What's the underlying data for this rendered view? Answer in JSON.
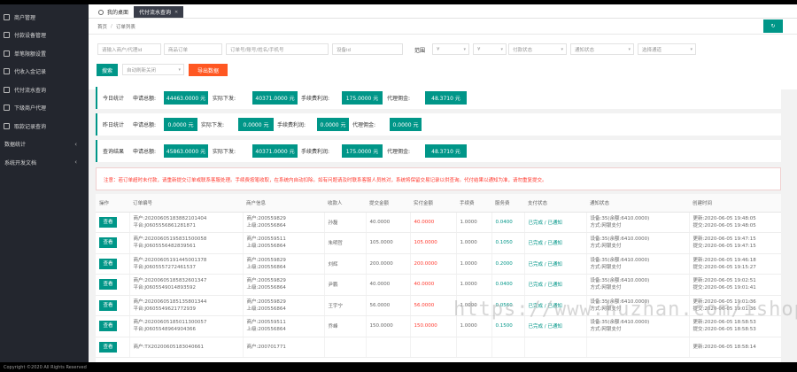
{
  "sidebar": {
    "items": [
      {
        "label": "商户管理",
        "arrow": ""
      },
      {
        "label": "付款设备管理",
        "arrow": ""
      },
      {
        "label": "单笔限额设置",
        "arrow": ""
      },
      {
        "label": "代收入金记录",
        "arrow": ""
      },
      {
        "label": "代付流水查询",
        "arrow": ""
      },
      {
        "label": "下级商户代理",
        "arrow": ""
      },
      {
        "label": "取款记录查询",
        "arrow": ""
      }
    ],
    "groups": [
      {
        "label": "数据统计",
        "arrow": "‹"
      },
      {
        "label": "系统开发文档",
        "arrow": "‹"
      }
    ]
  },
  "tabs": {
    "home": "我的桌面",
    "active": "代付流水查询",
    "close": "✕"
  },
  "breadcrumb": {
    "home": "首页",
    "sep": "/",
    "current": "订单列表"
  },
  "refresh_label": "↻",
  "filters": {
    "merchant_placeholder": "请输入商户/代理id",
    "order_placeholder": "商品订单",
    "ordinfo_placeholder": "订单号/账号/姓名/手机号",
    "device_placeholder": "设备id",
    "range_label": "范围",
    "min_placeholder": "¥",
    "max_placeholder": "¥",
    "pay_status": "付款状态",
    "notify_status": "通知状态",
    "channel": "选择通道",
    "search_label": "搜索",
    "auto_refresh": "自动刷新关闭",
    "export_label": "导出数据"
  },
  "stats": [
    {
      "title": "今日统计",
      "pay_label": "申请总额:",
      "pay": "44463.0000 元",
      "done_label": "实际下发:",
      "done": "40371.0000 元",
      "fee_label": "手续费利润:",
      "fee": "175.0000 元",
      "agent_label": "代理佣金:",
      "agent": "48.3710 元"
    },
    {
      "title": "昨日统计",
      "pay_label": "申请总额:",
      "pay": "0.0000 元",
      "done_label": "实际下发:",
      "done": "0.0000 元",
      "fee_label": "手续费利润:",
      "fee": "0.0000 元",
      "agent_label": "代理佣金:",
      "agent": "0.0000 元"
    },
    {
      "title": "查询结果",
      "pay_label": "申请总额:",
      "pay": "45863.0000 元",
      "done_label": "实际下发:",
      "done": "40371.0000 元",
      "fee_label": "手续费利润:",
      "fee": "175.0000 元",
      "agent_label": "代理佣金:",
      "agent": "48.3710 元"
    }
  ],
  "notice": "注意：若订单超时未付款，请重新提交订单或联系客服处理。手续费按笔收取，在系统内自动扣除。如有问题请及时联系客服人员核对，系统将保留交易记录以供查询。代付结果以通知为准，请勿重复提交。",
  "table": {
    "headers": [
      "操作",
      "订单编号",
      "商户信息",
      "收款人",
      "提交金额",
      "实付金额",
      "手续费",
      "服务费",
      "支付状态",
      "通知状态",
      "创建时间"
    ],
    "view_label": "查看",
    "rows": [
      {
        "order1": "商户:20200605183882101404",
        "order2": "平台:J0605556861281871",
        "m1": "商户:200559829",
        "m2": "上级:200556864",
        "payee": "孙磊",
        "amount": "40.0000",
        "paid": "40.0000",
        "fee": "1.0000",
        "svc": "0.0400",
        "status": "已完成 / 已通知",
        "ch1": "设备:35(余额:6410.0000)",
        "ch2": "方式:网银支付",
        "t1": "更新:2020-06-05 19:48:05",
        "t2": "提交:2020-06-05 19:48:05"
      },
      {
        "order1": "商户:20200605195831500058",
        "order2": "平台:J0605556482839561",
        "m1": "商户:200559511",
        "m2": "上级:200556864",
        "payee": "朱明哲",
        "amount": "105.0000",
        "paid": "105.0000",
        "fee": "1.0000",
        "svc": "0.1050",
        "status": "已完成 / 已通知",
        "ch1": "设备:35(余额:6410.0000)",
        "ch2": "方式:网银支付",
        "t1": "更新:2020-06-05 19:47:15",
        "t2": "提交:2020-06-05 19:47:15"
      },
      {
        "order1": "商户:20200605191445001378",
        "order2": "平台:J0605557272461537",
        "m1": "商户:200559829",
        "m2": "上级:200556864",
        "payee": "刘辉",
        "amount": "200.0000",
        "paid": "200.0000",
        "fee": "1.0000",
        "svc": "0.2000",
        "status": "已完成 / 已通知",
        "ch1": "设备:35(余额:6410.0000)",
        "ch2": "方式:网银支付",
        "t1": "更新:2020-06-05 19:46:18",
        "t2": "提交:2020-06-05 19:15:27"
      },
      {
        "order1": "商户:20200605185832601347",
        "order2": "平台:J0605549014893592",
        "m1": "商户:200559829",
        "m2": "上级:200556864",
        "payee": "尹鹏",
        "amount": "40.0000",
        "paid": "40.0000",
        "fee": "1.0000",
        "svc": "0.0400",
        "status": "已完成 / 已通知",
        "ch1": "设备:35(余额:6410.0000)",
        "ch2": "方式:网银支付",
        "t1": "更新:2020-06-05 19:02:51",
        "t2": "提交:2020-06-05 19:01:41"
      },
      {
        "order1": "商户:20200605185135801344",
        "order2": "平台:J0605549621772939",
        "m1": "商户:200559829",
        "m2": "上级:200556864",
        "payee": "王宇宁",
        "amount": "56.0000",
        "paid": "56.0000",
        "fee": "1.0000",
        "svc": "0.0560",
        "status": "已完成 / 已通知",
        "ch1": "设备:35(余额:6410.0000)",
        "ch2": "方式:网银支付",
        "t1": "更新:2020-06-05 19:01:36",
        "t2": "提交:2020-06-05 19:01:36"
      },
      {
        "order1": "商户:20200605185011300057",
        "order2": "平台:J0605548964904366",
        "m1": "商户:200559511",
        "m2": "上级:200556864",
        "payee": "乔峰",
        "amount": "150.0000",
        "paid": "150.0000",
        "fee": "1.0000",
        "svc": "0.1500",
        "status": "已完成 / 已通知",
        "ch1": "设备:35(余额:6410.0000)",
        "ch2": "方式:网银支付",
        "t1": "更新:2020-06-05 18:58:53",
        "t2": "提交:2020-06-05 18:58:53"
      },
      {
        "order1": "商户:TX20200605183040661",
        "order2": "",
        "m1": "商户:200701771",
        "m2": "",
        "payee": "",
        "amount": "",
        "paid": "",
        "fee": "",
        "svc": "",
        "status": "",
        "ch1": "",
        "ch2": "",
        "t1": "更新:2020-06-05 18:58:14",
        "t2": ""
      }
    ]
  },
  "footer": "Copyright ©2020 All Rights Reserved",
  "watermark": "https://www.huzhan.com/ishop16566"
}
